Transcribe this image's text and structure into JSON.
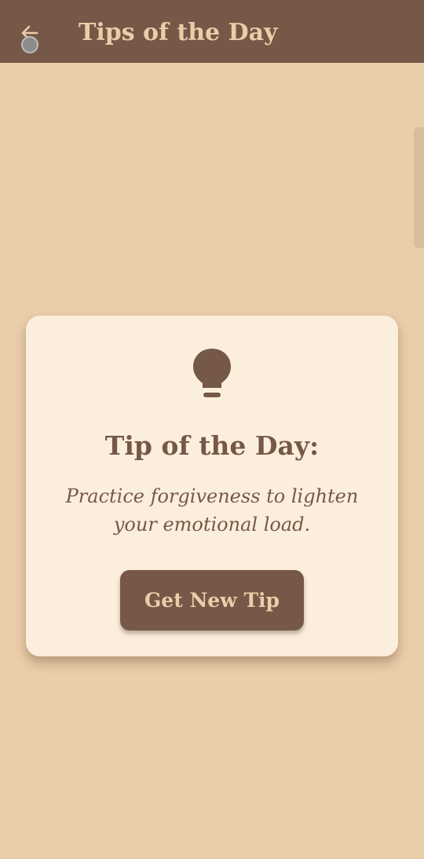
{
  "header": {
    "title": "Tips of the Day",
    "back_icon": "arrow-left-icon"
  },
  "card": {
    "icon": "lightbulb-icon",
    "title": "Tip of the Day:",
    "tip": "Practice forgiveness to lighten your emotional load.",
    "button_label": "Get New Tip"
  },
  "colors": {
    "background": "#EACDA9",
    "header": "#765848",
    "card": "#FCEEDD",
    "accent": "#765848"
  }
}
